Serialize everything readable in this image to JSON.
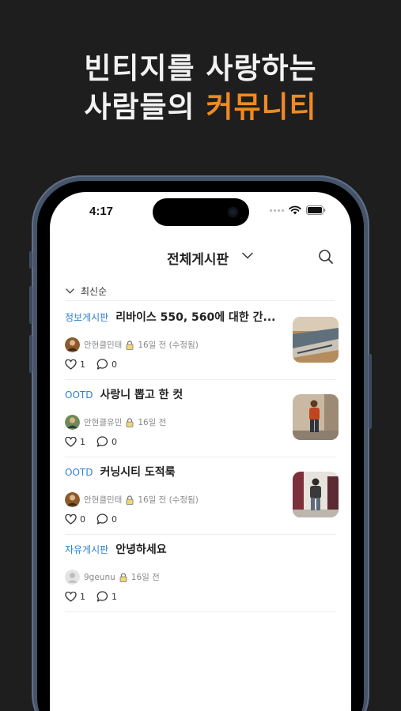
{
  "promo": {
    "line1": "빈티지를 사랑하는",
    "line2_prefix": "사람들의",
    "line2_accent": "커뮤니티"
  },
  "status_bar": {
    "time": "4:17"
  },
  "header": {
    "board_title": "전체게시판",
    "dropdown_icon": "chevron-down-icon",
    "search_icon": "search-icon"
  },
  "sort": {
    "label": "최신순",
    "icon": "chevron-down-icon"
  },
  "posts": [
    {
      "category": "정보게시판",
      "title": "리바이스 550, 560에 대한 간...",
      "author": "안현클민태",
      "time": "16일 전 (수정됨)",
      "likes": "1",
      "comments": "0",
      "has_thumbnail": true
    },
    {
      "category": "OOTD",
      "title": "사랑니 뽑고 한 컷",
      "author": "안현클유민",
      "time": "16일 전",
      "likes": "1",
      "comments": "0",
      "has_thumbnail": true
    },
    {
      "category": "OOTD",
      "title": "커닝시티 도적룩",
      "author": "안현클민태",
      "time": "16일 전 (수정됨)",
      "likes": "0",
      "comments": "0",
      "has_thumbnail": true
    },
    {
      "category": "자유게시판",
      "title": "안녕하세요",
      "author": "9geunu",
      "time": "16일 전",
      "likes": "1",
      "comments": "1",
      "has_thumbnail": false
    }
  ],
  "colors": {
    "background": "#1e1e1e",
    "accent": "#f08a24",
    "category_blue": "#2d7fd3",
    "phone_frame": "#46546a"
  }
}
